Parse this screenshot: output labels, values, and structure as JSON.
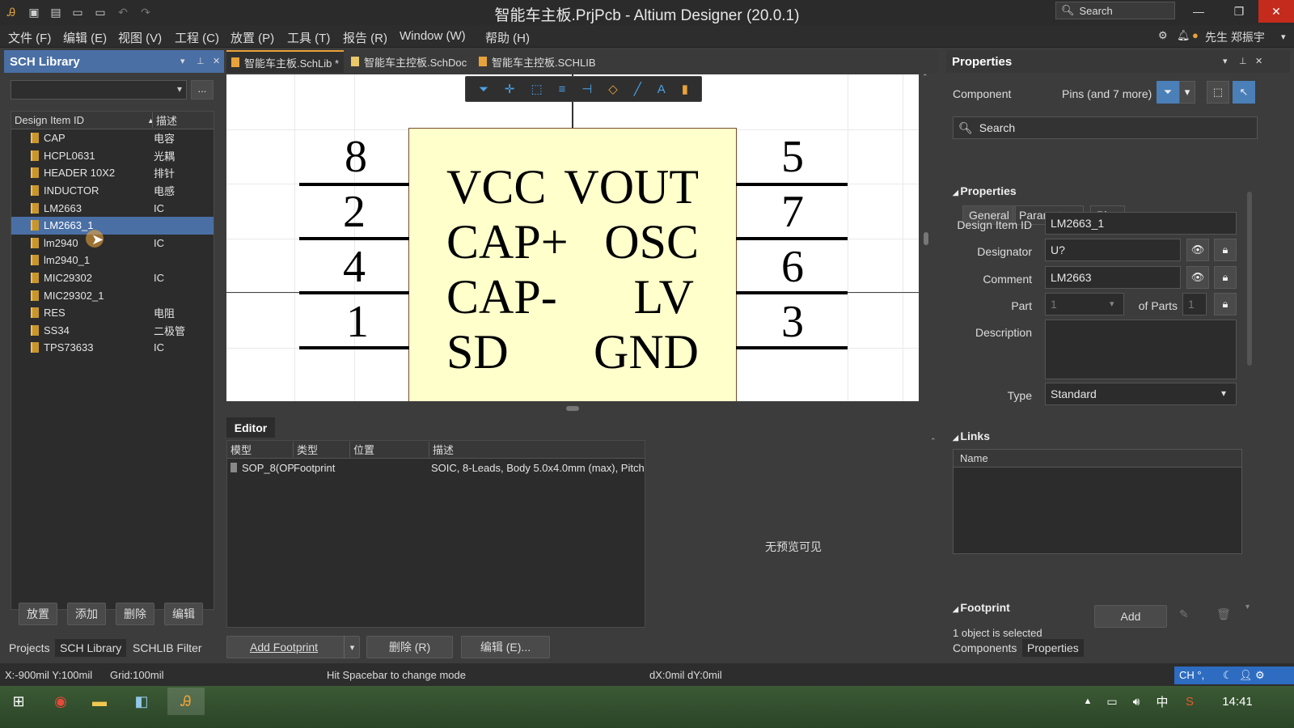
{
  "window": {
    "title": "智能车主板.PrjPcb - Altium Designer (20.0.1)",
    "search_placeholder": "Search"
  },
  "menu": [
    "文件 (F)",
    "编辑 (E)",
    "视图 (V)",
    "工程 (C)",
    "放置 (P)",
    "工具 (T)",
    "报告 (R)",
    "Window (W)",
    "帮助 (H)"
  ],
  "user": "先生 郑振宇",
  "sch_library": {
    "title": "SCH Library",
    "col_id": "Design Item ID",
    "col_desc": "描述",
    "items": [
      {
        "id": "CAP",
        "desc": "电容"
      },
      {
        "id": "HCPL0631",
        "desc": "光耦"
      },
      {
        "id": "HEADER 10X2",
        "desc": "排针"
      },
      {
        "id": "INDUCTOR",
        "desc": "电感"
      },
      {
        "id": "LM2663",
        "desc": "IC"
      },
      {
        "id": "LM2663_1",
        "desc": ""
      },
      {
        "id": "lm2940",
        "desc": "IC"
      },
      {
        "id": "lm2940_1",
        "desc": ""
      },
      {
        "id": "MIC29302",
        "desc": "IC"
      },
      {
        "id": "MIC29302_1",
        "desc": ""
      },
      {
        "id": "RES",
        "desc": "电阻"
      },
      {
        "id": "SS34",
        "desc": "二极管"
      },
      {
        "id": "TPS73633",
        "desc": "IC"
      }
    ],
    "buttons": [
      "放置",
      "添加",
      "删除",
      "编辑"
    ],
    "bottom_tabs": [
      "Projects",
      "SCH Library",
      "SCHLIB Filter"
    ]
  },
  "doc_tabs": [
    "智能车主板.SchLib *",
    "智能车主控板.SchDoc",
    "智能车主控板.SCHLIB"
  ],
  "component": {
    "left_pins": [
      {
        "num": "8",
        "label": "VCC"
      },
      {
        "num": "2",
        "label": "CAP+"
      },
      {
        "num": "4",
        "label": "CAP-"
      },
      {
        "num": "1",
        "label": "SD"
      }
    ],
    "right_pins": [
      {
        "num": "5",
        "label": "VOUT"
      },
      {
        "num": "7",
        "label": "OSC"
      },
      {
        "num": "6",
        "label": "LV"
      },
      {
        "num": "3",
        "label": "GND"
      }
    ]
  },
  "editor": {
    "title": "Editor",
    "columns": [
      "模型",
      "类型",
      "位置",
      "描述"
    ],
    "row": {
      "model": "SOP_8(OP.",
      "type": "Footprint",
      "loc": "",
      "desc": "SOIC, 8-Leads, Body 5.0x4.0mm (max), Pitch"
    },
    "no_preview": "无预览可见",
    "buttons": {
      "add": "Add Footprint",
      "delete": "删除 (R)",
      "edit": "编辑 (E)..."
    }
  },
  "properties": {
    "title": "Properties",
    "filter_label": "Component",
    "filter_value": "Pins (and 7 more)",
    "search_placeholder": "Search",
    "tabs": [
      "General",
      "Parameters",
      "Pins"
    ],
    "section_props": "Properties",
    "design_item_label": "Design Item ID",
    "design_item_value": "LM2663_1",
    "designator_label": "Designator",
    "designator_value": "U?",
    "comment_label": "Comment",
    "comment_value": "LM2663",
    "part_label": "Part",
    "part_value": "1",
    "of_parts_label": "of Parts",
    "of_parts_value": "1",
    "description_label": "Description",
    "type_label": "Type",
    "type_value": "Standard",
    "section_links": "Links",
    "links_col": "Name",
    "add_button": "Add",
    "section_footprint": "Footprint",
    "selection_status": "1 object is selected",
    "bottom_tabs": [
      "Components",
      "Properties"
    ]
  },
  "status": {
    "coords": "X:-900mil Y:100mil",
    "grid": "Grid:100mil",
    "hint": "Hit Spacebar to change mode",
    "delta": "dX:0mil dY:0mil",
    "ime": "CH °,"
  },
  "taskbar": {
    "time": "14:41",
    "lang": "中"
  }
}
